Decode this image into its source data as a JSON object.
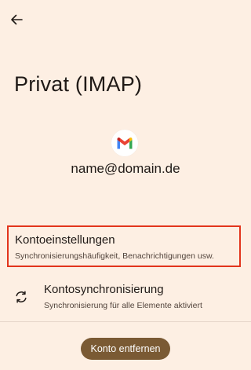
{
  "header": {
    "back_icon": "arrow-left-icon"
  },
  "account": {
    "title": "Privat (IMAP)",
    "avatar_icon": "gmail-logo-icon",
    "email": "name@domain.de"
  },
  "settings": {
    "account_settings": {
      "title": "Kontoeinstellungen",
      "subtitle": "Synchronisierungshäufigkeit, Benachrichtigungen usw.",
      "highlight_color": "#e2341c"
    },
    "account_sync": {
      "icon": "sync-icon",
      "title": "Kontosynchronisierung",
      "subtitle": "Synchronisierung für alle Elemente aktiviert"
    }
  },
  "actions": {
    "remove_account_label": "Konto entfernen",
    "button_color": "#7a5a34"
  },
  "colors": {
    "background": "#fdefe3",
    "text": "#201a17"
  }
}
